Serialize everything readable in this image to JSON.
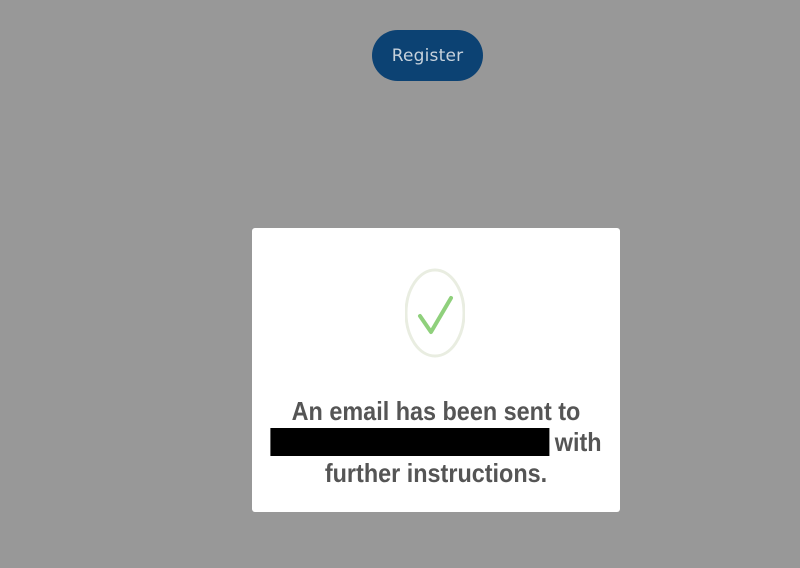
{
  "register_button": {
    "label": "Register"
  },
  "modal": {
    "icon": "checkmark-icon",
    "message": {
      "line1": "An email has been sent to",
      "line2_suffix": "with",
      "line3": "further instructions."
    }
  },
  "colors": {
    "background": "#989898",
    "button": "#0c4273",
    "check": "#8fd07c",
    "text": "#555555"
  }
}
